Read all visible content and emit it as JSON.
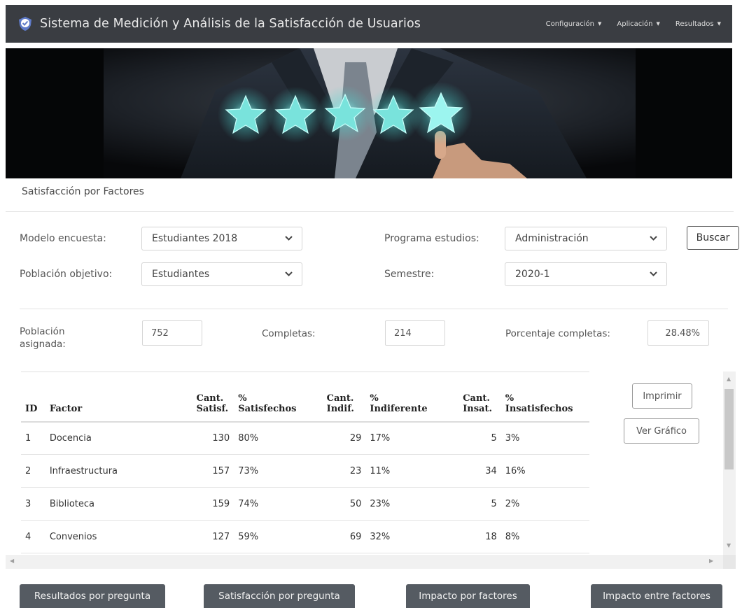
{
  "app": {
    "title": "Sistema de Medición y Análisis de la Satisfacción de Usuarios"
  },
  "nav": {
    "items": [
      {
        "label": "Configuración"
      },
      {
        "label": "Aplicación"
      },
      {
        "label": "Resultados"
      }
    ],
    "caret": "▼"
  },
  "page": {
    "section_title": "Satisfacción por Factores"
  },
  "filters": {
    "modelo_label": "Modelo encuesta:",
    "modelo_value": "Estudiantes 2018",
    "poblacion_label": "Población objetivo:",
    "poblacion_value": "Estudiantes",
    "programa_label": "Programa estudios:",
    "programa_value": "Administración",
    "semestre_label": "Semestre:",
    "semestre_value": "2020-1",
    "buscar_label": "Buscar"
  },
  "stats": {
    "asignada_label_1": "Población",
    "asignada_label_2": "asignada:",
    "asignada_value": "752",
    "completas_label": "Completas:",
    "completas_value": "214",
    "porcentaje_label": "Porcentaje completas:",
    "porcentaje_value": "28.48%"
  },
  "table": {
    "headers": {
      "id": "ID",
      "factor": "Factor",
      "cant_satisf_1": "Cant.",
      "cant_satisf_2": "Satisf.",
      "pct_satisf_1": "%",
      "pct_satisf_2": "Satisfechos",
      "cant_indif_1": "Cant.",
      "cant_indif_2": "Indif.",
      "pct_indif_1": "%",
      "pct_indif_2": "Indiferente",
      "cant_insat_1": "Cant.",
      "cant_insat_2": "Insat.",
      "pct_insat_1": "%",
      "pct_insat_2": "Insatisfechos"
    },
    "rows": [
      {
        "id": "1",
        "factor": "Docencia",
        "cant_satisf": "130",
        "pct_satisf": "80%",
        "cant_indif": "29",
        "pct_indif": "17%",
        "cant_insat": "5",
        "pct_insat": "3%"
      },
      {
        "id": "2",
        "factor": "Infraestructura",
        "cant_satisf": "157",
        "pct_satisf": "73%",
        "cant_indif": "23",
        "pct_indif": "11%",
        "cant_insat": "34",
        "pct_insat": "16%"
      },
      {
        "id": "3",
        "factor": "Biblioteca",
        "cant_satisf": "159",
        "pct_satisf": "74%",
        "cant_indif": "50",
        "pct_indif": "23%",
        "cant_insat": "5",
        "pct_insat": "2%"
      },
      {
        "id": "4",
        "factor": "Convenios",
        "cant_satisf": "127",
        "pct_satisf": "59%",
        "cant_indif": "69",
        "pct_indif": "32%",
        "cant_insat": "18",
        "pct_insat": "8%"
      }
    ]
  },
  "actions": {
    "imprimir": "Imprimir",
    "ver_grafico": "Ver Gráfico"
  },
  "bottom_buttons": {
    "resultados_pregunta": "Resultados por pregunta",
    "satisfaccion_pregunta": "Satisfacción por pregunta",
    "impacto_factores": "Impacto por factores",
    "impacto_entre": "Impacto entre factores"
  },
  "icons": {
    "brand": "shield-check-icon",
    "chevron": "chevron-down-icon",
    "scroll_up": "▲",
    "scroll_down": "▼",
    "scroll_left": "◀",
    "scroll_right": "▶"
  },
  "colors": {
    "navbar": "#3a3d42",
    "button_dark": "#555b62",
    "star_glow": "#7ff3ef"
  }
}
